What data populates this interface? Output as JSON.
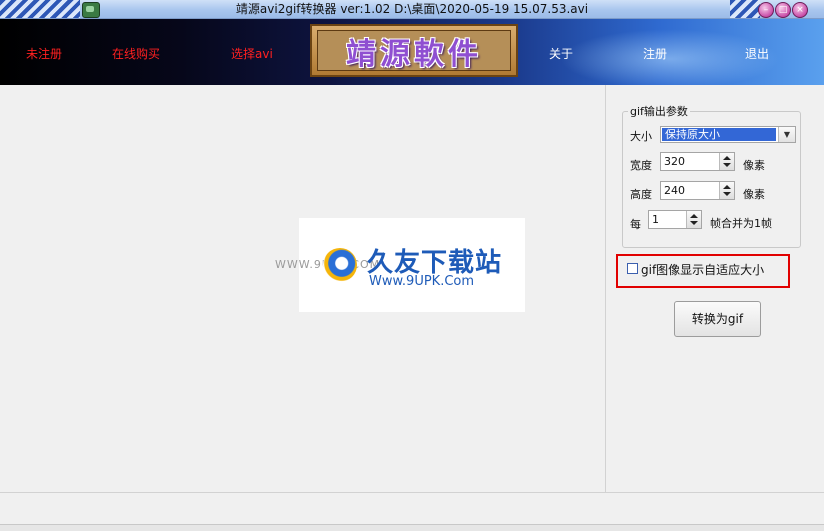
{
  "window": {
    "title": "靖源avi2gif转换器 ver:1.02 D:\\桌面\\2020-05-19 15.07.53.avi",
    "min_glyph": "–",
    "max_glyph": "□",
    "close_glyph": "×"
  },
  "menu": {
    "unregistered": "未注册",
    "buy_online": "在线购买",
    "select_avi": "选择avi",
    "about": "关于",
    "register": "注册",
    "exit": "退出"
  },
  "brand": {
    "logo_text": "靖源軟件"
  },
  "watermark": {
    "small_url": "WWW.9UPK.COM",
    "title": "久友下载站",
    "subtitle": "Www.9UPK.Com"
  },
  "gif_params": {
    "group_title": "gif输出参数",
    "size_label": "大小",
    "size_value": "保持原大小",
    "width_label": "宽度",
    "width_value": "320",
    "width_unit": "像素",
    "height_label": "高度",
    "height_value": "240",
    "height_unit": "像素",
    "every_label": "每",
    "frame_value": "1",
    "frame_suffix": "帧合并为1帧"
  },
  "adaptive": {
    "checkbox_label": "gif图像显示自适应大小",
    "checked": false
  },
  "actions": {
    "convert_label": "转换为gif"
  },
  "colors": {
    "menu_red": "#ff2020",
    "highlight_red": "#e10000",
    "select_blue": "#3367d6"
  }
}
